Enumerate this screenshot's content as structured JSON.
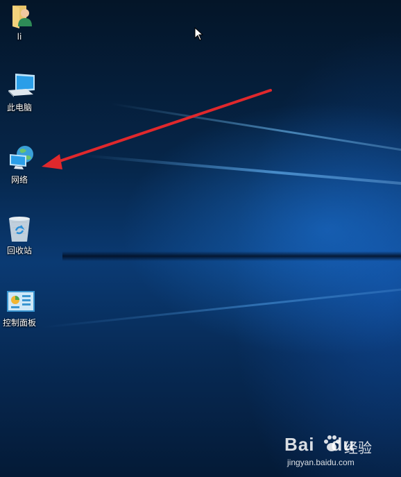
{
  "desktop": {
    "icons": [
      {
        "name": "user-folder-icon",
        "label": "li"
      },
      {
        "name": "this-pc-icon",
        "label": "此电脑"
      },
      {
        "name": "network-icon",
        "label": "网络"
      },
      {
        "name": "recycle-bin-icon",
        "label": "回收站"
      },
      {
        "name": "control-panel-icon",
        "label": "控制面板"
      }
    ]
  },
  "annotation": {
    "icon": "red-arrow-icon",
    "color": "#e0282c"
  },
  "cursor": {
    "icon": "mouse-pointer-icon"
  },
  "watermark": {
    "brand": "Bai",
    "brand_tail": "du",
    "cn_text": "经验",
    "url": "jingyan.baidu.com"
  },
  "colors": {
    "accent": "#1a78d4",
    "label_text": "#ffffff"
  }
}
